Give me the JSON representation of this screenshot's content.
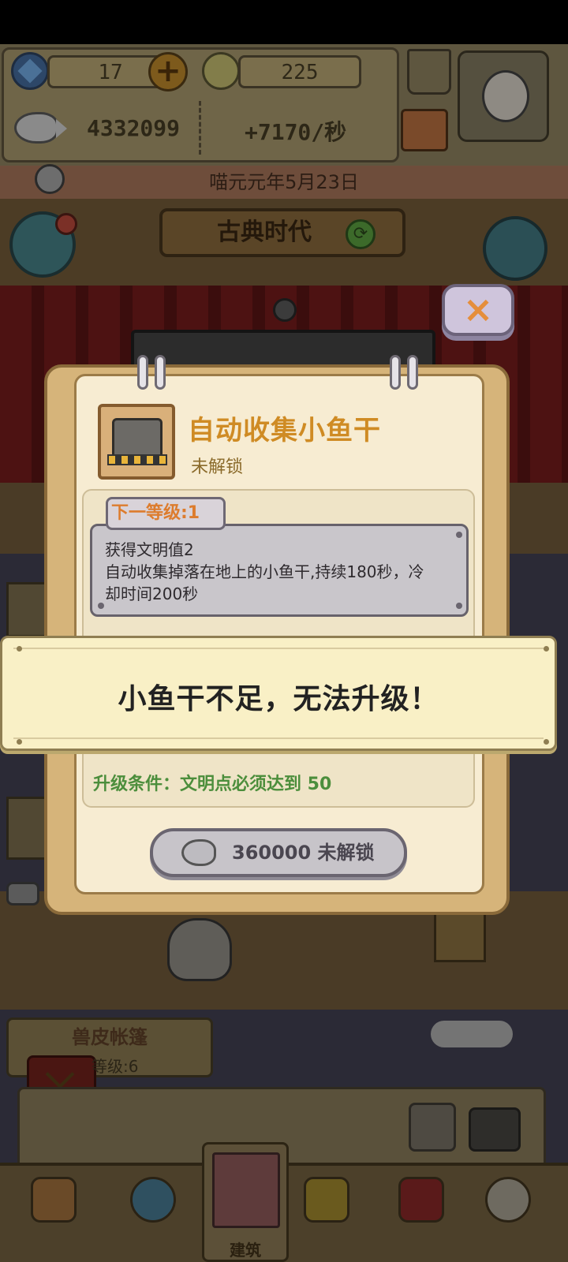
{
  "hud": {
    "gems": "17",
    "coins": "225",
    "fish_total": "4332099",
    "fish_rate": "+7170/秒",
    "date": "喵元元年5月23日",
    "era": "古典时代"
  },
  "popup": {
    "title": "自动收集小鱼干",
    "status": "未解锁",
    "next_level": "下一等级:1",
    "desc_line1": "获得文明值2",
    "desc_line2": "自动收集掉落在地上的小鱼干,持续180秒，冷",
    "desc_line3": "却时间200秒",
    "upgrade_condition": "升级条件：文明点必须达到 50",
    "unlock_button": "360000 未解锁",
    "close": "×"
  },
  "toast": {
    "message": "小鱼干不足，无法升级！"
  },
  "scene": {
    "leather_title": "兽皮帐篷",
    "leather_level": "等级:6"
  },
  "nav": {
    "center_label": "建筑"
  }
}
